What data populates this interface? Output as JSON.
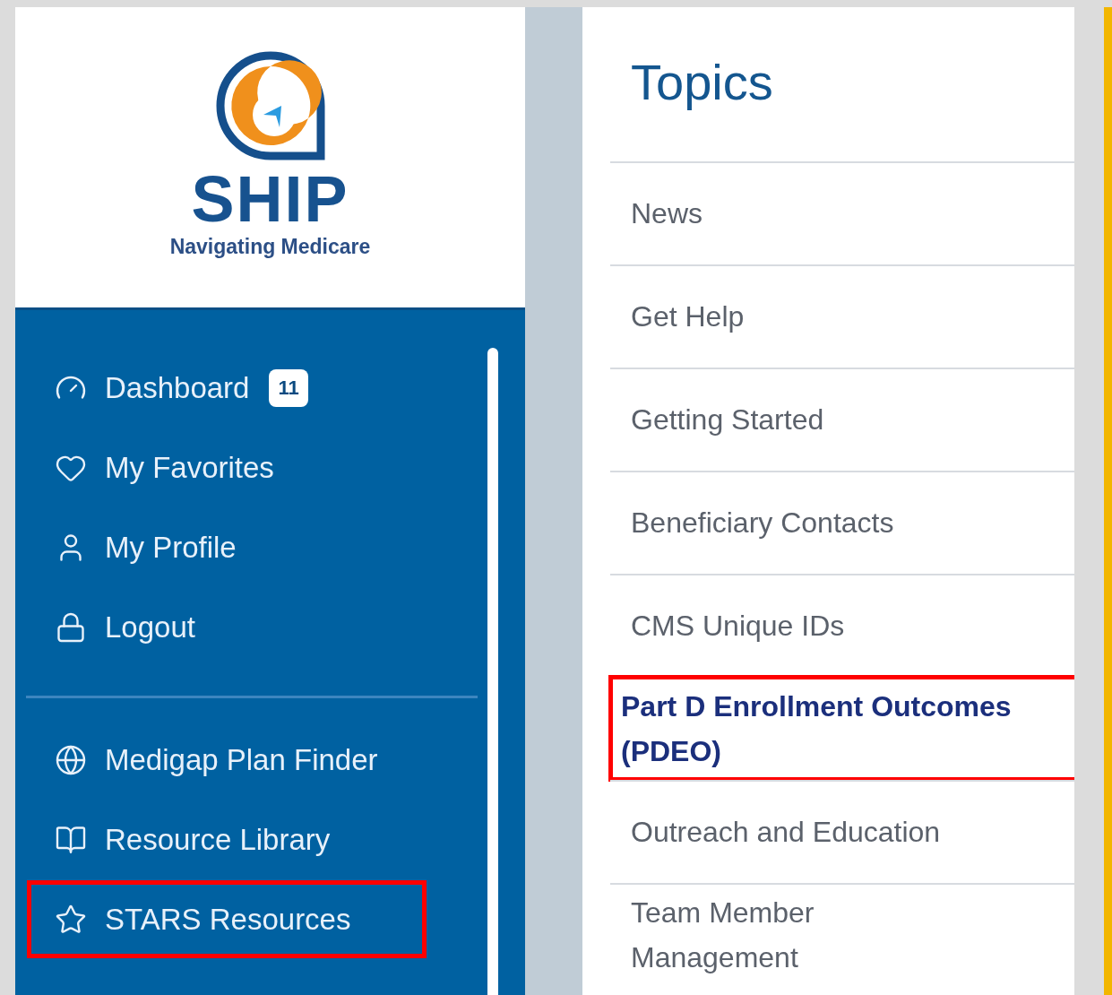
{
  "logo": {
    "name": "SHIP",
    "tagline": "Navigating Medicare"
  },
  "sidebar": {
    "items": [
      {
        "label": "Dashboard",
        "kind": "gauge",
        "badge": "11",
        "highlighted": false
      },
      {
        "label": "My Favorites",
        "kind": "heart",
        "highlighted": false
      },
      {
        "label": "My Profile",
        "kind": "user",
        "highlighted": false
      },
      {
        "label": "Logout",
        "kind": "lock",
        "highlighted": false
      }
    ],
    "tools": [
      {
        "label": "Medigap Plan Finder",
        "kind": "globe",
        "highlighted": false
      },
      {
        "label": "Resource Library",
        "kind": "book",
        "highlighted": false
      },
      {
        "label": "STARS Resources",
        "kind": "star",
        "highlighted": true
      }
    ]
  },
  "topics": {
    "title": "Topics",
    "items": [
      {
        "label": "News",
        "selected": false,
        "highlighted": false
      },
      {
        "label": "Get Help",
        "selected": false,
        "highlighted": false
      },
      {
        "label": "Getting Started",
        "selected": false,
        "highlighted": false
      },
      {
        "label": "Beneficiary Contacts",
        "selected": false,
        "highlighted": false
      },
      {
        "label": "CMS Unique IDs",
        "selected": false,
        "highlighted": false
      },
      {
        "label": "Part D Enrollment Outcomes (PDEO)",
        "selected": true,
        "highlighted": true
      },
      {
        "label": "Outreach and Education",
        "selected": false,
        "highlighted": false
      },
      {
        "label": "Team Member Management",
        "selected": false,
        "highlighted": false
      }
    ]
  }
}
